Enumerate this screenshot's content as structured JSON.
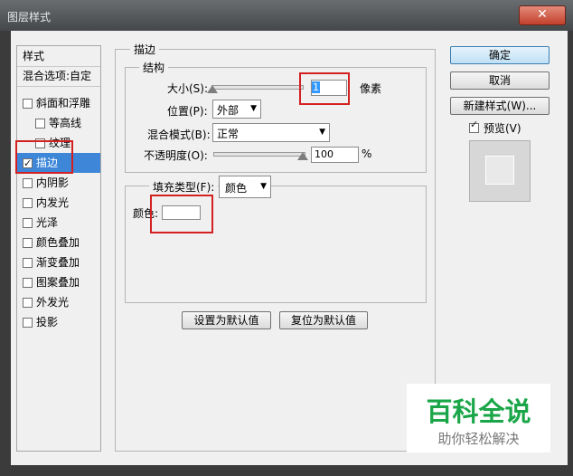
{
  "window": {
    "title": "图层样式",
    "close_glyph": "✕"
  },
  "left_panel": {
    "header": "样式",
    "blend_options": "混合选项:自定",
    "items": [
      {
        "label": "斜面和浮雕",
        "checked": false,
        "indent": false
      },
      {
        "label": "等高线",
        "checked": false,
        "indent": true
      },
      {
        "label": "纹理",
        "checked": false,
        "indent": true
      },
      {
        "label": "描边",
        "checked": true,
        "indent": false,
        "selected": true
      },
      {
        "label": "内阴影",
        "checked": false,
        "indent": false
      },
      {
        "label": "内发光",
        "checked": false,
        "indent": false
      },
      {
        "label": "光泽",
        "checked": false,
        "indent": false
      },
      {
        "label": "颜色叠加",
        "checked": false,
        "indent": false
      },
      {
        "label": "渐变叠加",
        "checked": false,
        "indent": false
      },
      {
        "label": "图案叠加",
        "checked": false,
        "indent": false
      },
      {
        "label": "外发光",
        "checked": false,
        "indent": false
      },
      {
        "label": "投影",
        "checked": false,
        "indent": false
      }
    ]
  },
  "stroke": {
    "title": "描边",
    "structure": {
      "title": "结构",
      "size_label": "大小(S):",
      "size_value": "1",
      "size_unit": "像素",
      "position_label": "位置(P):",
      "position_value": "外部",
      "blend_label": "混合模式(B):",
      "blend_value": "正常",
      "opacity_label": "不透明度(O):",
      "opacity_value": "100",
      "opacity_unit": "%"
    },
    "fill": {
      "type_label": "填充类型(F):",
      "type_value": "颜色",
      "color_label": "颜色:",
      "color_value": "#ffffff"
    },
    "set_default": "设置为默认值",
    "reset_default": "复位为默认值"
  },
  "buttons": {
    "ok": "确定",
    "cancel": "取消",
    "new_style": "新建样式(W)...",
    "preview": "预览(V)"
  },
  "watermark": {
    "brand": "百科全说",
    "sub": "助你轻松解决"
  },
  "colors": {
    "selected": "#3d86d8",
    "annotation_red": "#d32121",
    "brand_green": "#1aa648"
  }
}
